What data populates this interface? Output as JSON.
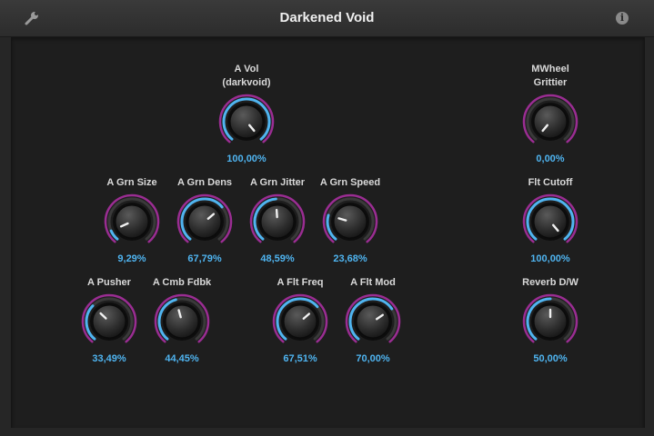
{
  "window": {
    "title": "Darkened Void"
  },
  "icons": {
    "settings": "wrench-icon",
    "info": "info-icon",
    "info_glyph": "i"
  },
  "colors": {
    "accent": "#4fb4f0",
    "ring_outer": "#9a2d92",
    "ring_track": "#3a3a3a"
  },
  "knobs": [
    {
      "id": "a-vol",
      "label": "A Vol\n(darkvoid)",
      "value_text": "100,00%",
      "value": 1.0
    },
    {
      "id": "mwheel-grittier",
      "label": "MWheel\nGrittier",
      "value_text": "0,00%",
      "value": 0.0
    },
    {
      "id": "a-grn-size",
      "label": "A Grn Size",
      "value_text": "9,29%",
      "value": 0.0929
    },
    {
      "id": "a-grn-dens",
      "label": "A Grn Dens",
      "value_text": "67,79%",
      "value": 0.6779
    },
    {
      "id": "a-grn-jitter",
      "label": "A Grn Jitter",
      "value_text": "48,59%",
      "value": 0.4859
    },
    {
      "id": "a-grn-speed",
      "label": "A Grn Speed",
      "value_text": "23,68%",
      "value": 0.2368
    },
    {
      "id": "flt-cutoff",
      "label": "Flt Cutoff",
      "value_text": "100,00%",
      "value": 1.0
    },
    {
      "id": "a-pusher",
      "label": "A Pusher",
      "value_text": "33,49%",
      "value": 0.3349
    },
    {
      "id": "a-cmb-fdbk",
      "label": "A Cmb Fdbk",
      "value_text": "44,45%",
      "value": 0.4445
    },
    {
      "id": "a-flt-freq",
      "label": "A Flt Freq",
      "value_text": "67,51%",
      "value": 0.6751
    },
    {
      "id": "a-flt-mod",
      "label": "A Flt Mod",
      "value_text": "70,00%",
      "value": 0.7
    },
    {
      "id": "reverb-dw",
      "label": "Reverb D/W",
      "value_text": "50,00%",
      "value": 0.5
    }
  ]
}
